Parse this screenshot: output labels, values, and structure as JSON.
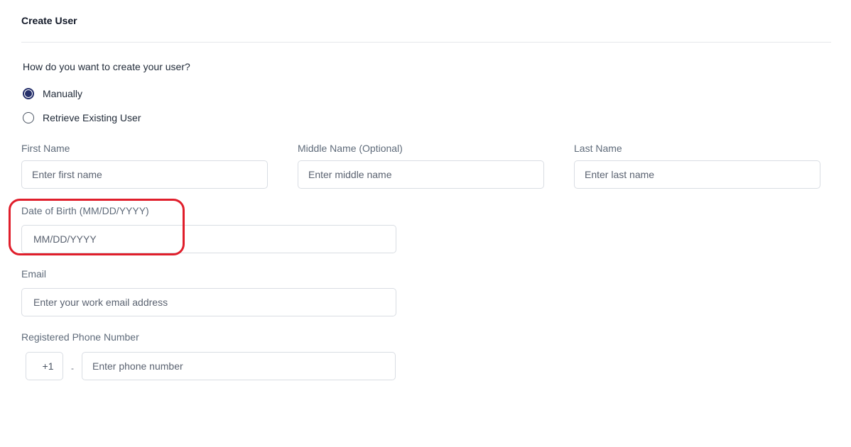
{
  "header": {
    "title": "Create User"
  },
  "question": "How do you want to create your user?",
  "options": [
    {
      "label": "Manually",
      "checked": true
    },
    {
      "label": "Retrieve Existing User",
      "checked": false
    }
  ],
  "fields": {
    "first_name": {
      "label": "First Name",
      "placeholder": "Enter first name",
      "value": ""
    },
    "middle_name": {
      "label": "Middle Name (Optional)",
      "placeholder": "Enter middle name",
      "value": ""
    },
    "last_name": {
      "label": "Last Name",
      "placeholder": "Enter last name",
      "value": ""
    },
    "dob": {
      "label": "Date of Birth (MM/DD/YYYY)",
      "placeholder": "MM/DD/YYYY",
      "value": ""
    },
    "email": {
      "label": "Email",
      "placeholder": "Enter your work email address",
      "value": ""
    },
    "phone": {
      "label": "Registered Phone Number",
      "country_code": "+1",
      "separator": "-",
      "placeholder": "Enter phone number",
      "value": ""
    }
  },
  "colors": {
    "accent": "#26306b",
    "highlight": "#e01e2b",
    "border": "#d9dde3"
  }
}
